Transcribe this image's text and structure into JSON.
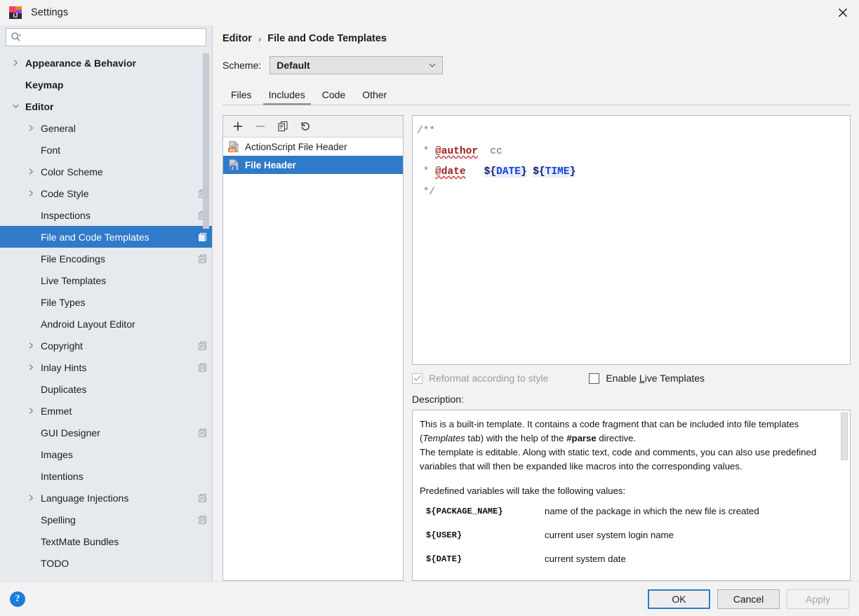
{
  "window": {
    "title": "Settings",
    "app_icon": "intellij-idea-icon",
    "close_icon": "close-icon"
  },
  "search": {
    "placeholder": "",
    "value": "",
    "icon": "search-icon"
  },
  "sidebar": {
    "items": [
      {
        "label": "Appearance & Behavior",
        "indent": 0,
        "arrow": "chevron-right",
        "bold": true,
        "cfg": false,
        "selected": false
      },
      {
        "label": "Keymap",
        "indent": 0,
        "arrow": "none",
        "bold": true,
        "cfg": false,
        "selected": false
      },
      {
        "label": "Editor",
        "indent": 0,
        "arrow": "chevron-down",
        "bold": true,
        "cfg": false,
        "selected": false
      },
      {
        "label": "General",
        "indent": 1,
        "arrow": "chevron-right",
        "bold": false,
        "cfg": false,
        "selected": false
      },
      {
        "label": "Font",
        "indent": 1,
        "arrow": "none",
        "bold": false,
        "cfg": false,
        "selected": false
      },
      {
        "label": "Color Scheme",
        "indent": 1,
        "arrow": "chevron-right",
        "bold": false,
        "cfg": false,
        "selected": false
      },
      {
        "label": "Code Style",
        "indent": 1,
        "arrow": "chevron-right",
        "bold": false,
        "cfg": true,
        "selected": false
      },
      {
        "label": "Inspections",
        "indent": 1,
        "arrow": "none",
        "bold": false,
        "cfg": true,
        "selected": false
      },
      {
        "label": "File and Code Templates",
        "indent": 1,
        "arrow": "none",
        "bold": false,
        "cfg": true,
        "selected": true
      },
      {
        "label": "File Encodings",
        "indent": 1,
        "arrow": "none",
        "bold": false,
        "cfg": true,
        "selected": false
      },
      {
        "label": "Live Templates",
        "indent": 1,
        "arrow": "none",
        "bold": false,
        "cfg": false,
        "selected": false
      },
      {
        "label": "File Types",
        "indent": 1,
        "arrow": "none",
        "bold": false,
        "cfg": false,
        "selected": false
      },
      {
        "label": "Android Layout Editor",
        "indent": 1,
        "arrow": "none",
        "bold": false,
        "cfg": false,
        "selected": false
      },
      {
        "label": "Copyright",
        "indent": 1,
        "arrow": "chevron-right",
        "bold": false,
        "cfg": true,
        "selected": false
      },
      {
        "label": "Inlay Hints",
        "indent": 1,
        "arrow": "chevron-right",
        "bold": false,
        "cfg": true,
        "selected": false
      },
      {
        "label": "Duplicates",
        "indent": 1,
        "arrow": "none",
        "bold": false,
        "cfg": false,
        "selected": false
      },
      {
        "label": "Emmet",
        "indent": 1,
        "arrow": "chevron-right",
        "bold": false,
        "cfg": false,
        "selected": false
      },
      {
        "label": "GUI Designer",
        "indent": 1,
        "arrow": "none",
        "bold": false,
        "cfg": true,
        "selected": false
      },
      {
        "label": "Images",
        "indent": 1,
        "arrow": "none",
        "bold": false,
        "cfg": false,
        "selected": false
      },
      {
        "label": "Intentions",
        "indent": 1,
        "arrow": "none",
        "bold": false,
        "cfg": false,
        "selected": false
      },
      {
        "label": "Language Injections",
        "indent": 1,
        "arrow": "chevron-right",
        "bold": false,
        "cfg": true,
        "selected": false
      },
      {
        "label": "Spelling",
        "indent": 1,
        "arrow": "none",
        "bold": false,
        "cfg": true,
        "selected": false
      },
      {
        "label": "TextMate Bundles",
        "indent": 1,
        "arrow": "none",
        "bold": false,
        "cfg": false,
        "selected": false
      },
      {
        "label": "TODO",
        "indent": 1,
        "arrow": "none",
        "bold": false,
        "cfg": false,
        "selected": false
      }
    ]
  },
  "main": {
    "breadcrumb": {
      "root": "Editor",
      "separator": "›",
      "leaf": "File and Code Templates"
    },
    "scheme": {
      "label": "Scheme:",
      "value": "Default",
      "chevron": "chevron-down-icon"
    },
    "tabs": [
      {
        "label": "Files",
        "active": false
      },
      {
        "label": "Includes",
        "active": true
      },
      {
        "label": "Code",
        "active": false
      },
      {
        "label": "Other",
        "active": false
      }
    ]
  },
  "template_list": {
    "toolbar": [
      {
        "name": "add-template-button",
        "glyph": "plus-icon",
        "disabled": false
      },
      {
        "name": "remove-template-button",
        "glyph": "minus-icon",
        "disabled": true
      },
      {
        "name": "copy-template-button",
        "glyph": "copy-icon",
        "disabled": false
      },
      {
        "name": "reset-template-button",
        "glyph": "revert-icon",
        "disabled": false
      }
    ],
    "items": [
      {
        "label": "ActionScript File Header",
        "badge": "AS",
        "badge_color": "#e8833a",
        "selected": false
      },
      {
        "label": "File Header",
        "badge": "J",
        "badge_color": "#3a7fd5",
        "selected": true
      }
    ]
  },
  "editor": {
    "lines": [
      [
        {
          "t": "/**",
          "s": "com"
        }
      ],
      [
        {
          "t": " * ",
          "s": "com"
        },
        {
          "t": "@author",
          "s": "tag"
        },
        {
          "t": "  cc",
          "s": "txt"
        }
      ],
      [
        {
          "t": " * ",
          "s": "com"
        },
        {
          "t": "@date",
          "s": "tag"
        },
        {
          "t": "   ",
          "s": "txt"
        },
        {
          "t": "${",
          "s": "brace"
        },
        {
          "t": "DATE",
          "s": "varname"
        },
        {
          "t": "}",
          "s": "brace"
        },
        {
          "t": " ",
          "s": "txt"
        },
        {
          "t": "${",
          "s": "brace"
        },
        {
          "t": "TIME",
          "s": "varname"
        },
        {
          "t": "}",
          "s": "brace"
        }
      ],
      [
        {
          "t": " */",
          "s": "com"
        }
      ]
    ]
  },
  "options": {
    "reformat": {
      "label": "Reformat according to style",
      "checked": true,
      "disabled": true
    },
    "live_templates": {
      "label_before": "Enable ",
      "mnemonic": "L",
      "label_after": "ive Templates",
      "checked": false,
      "disabled": false
    }
  },
  "description": {
    "title": "Description:",
    "paragraph1_a": "This is a built-in template. It contains a code fragment that can be included into file templates (",
    "paragraph1_italic": "Templates",
    "paragraph1_b": " tab) with the help of the ",
    "paragraph1_bold": "#parse",
    "paragraph1_c": " directive.",
    "paragraph2": "The template is editable. Along with static text, code and comments, you can also use predefined variables that will then be expanded like macros into the corresponding values.",
    "paragraph3": "Predefined variables will take the following values:",
    "variables": [
      {
        "name": "${PACKAGE_NAME}",
        "desc": "name of the package in which the new file is created"
      },
      {
        "name": "${USER}",
        "desc": "current user system login name"
      },
      {
        "name": "${DATE}",
        "desc": "current system date"
      }
    ]
  },
  "footer": {
    "help_icon": "help-icon",
    "help_glyph": "?",
    "buttons": [
      {
        "label": "OK",
        "style": "default",
        "disabled": false
      },
      {
        "label": "Cancel",
        "style": "normal",
        "disabled": false
      },
      {
        "label": "Apply",
        "style": "disabled",
        "disabled": true
      }
    ]
  },
  "colors": {
    "accent": "#2f7ac9",
    "sidebar_bg": "#e6eaee",
    "dialog_bg": "#f2f2f2",
    "help_blue": "#1d7cd6"
  }
}
